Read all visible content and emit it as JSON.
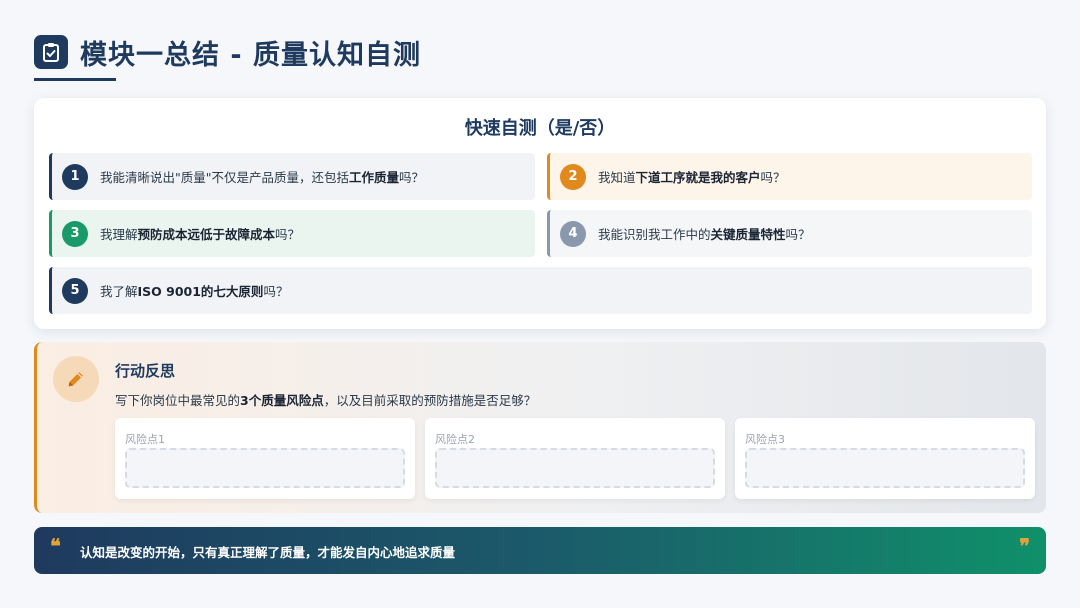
{
  "header": {
    "title": "模块一总结 - 质量认知自测",
    "icon": "clipboard-check-icon"
  },
  "self_test": {
    "title": "快速自测（是/否）",
    "questions": [
      {
        "num": "1",
        "pre": "我能清晰说出\"质量\"不仅是产品质量，还包括",
        "bold": "工作质量",
        "post": "吗？",
        "color": "#1e3a5f"
      },
      {
        "num": "2",
        "pre": "我知道",
        "bold": "下道工序就是我的客户",
        "post": "吗？",
        "color": "#e08a1e"
      },
      {
        "num": "3",
        "pre": "我理解",
        "bold": "预防成本远低于故障成本",
        "post": "吗？",
        "color": "#1a9a6a"
      },
      {
        "num": "4",
        "pre": "我能识别我工作中的",
        "bold": "关键质量特性",
        "post": "吗？",
        "color": "#8a98ad"
      },
      {
        "num": "5",
        "pre": "我了解",
        "bold": "ISO 9001的七大原则",
        "post": "吗？",
        "color": "#1e3a5f"
      }
    ]
  },
  "reflection": {
    "icon": "pencil-icon",
    "title": "行动反思",
    "desc_pre": "写下你岗位中最常见的",
    "desc_bold": "3个质量风险点",
    "desc_post": "，以及目前采取的预防措施是否足够？",
    "risks": [
      {
        "label": "风险点1",
        "value": ""
      },
      {
        "label": "风险点2",
        "value": ""
      },
      {
        "label": "风险点3",
        "value": ""
      }
    ]
  },
  "quote": {
    "open_mark": "❝",
    "text": "认知是改变的开始，只有真正理解了质量，才能发自内心地追求质量",
    "close_mark": "❞"
  },
  "colors": {
    "primary": "#1e3a5f",
    "orange": "#e08a1e",
    "green": "#1a9a6a",
    "gray": "#8a98ad"
  }
}
